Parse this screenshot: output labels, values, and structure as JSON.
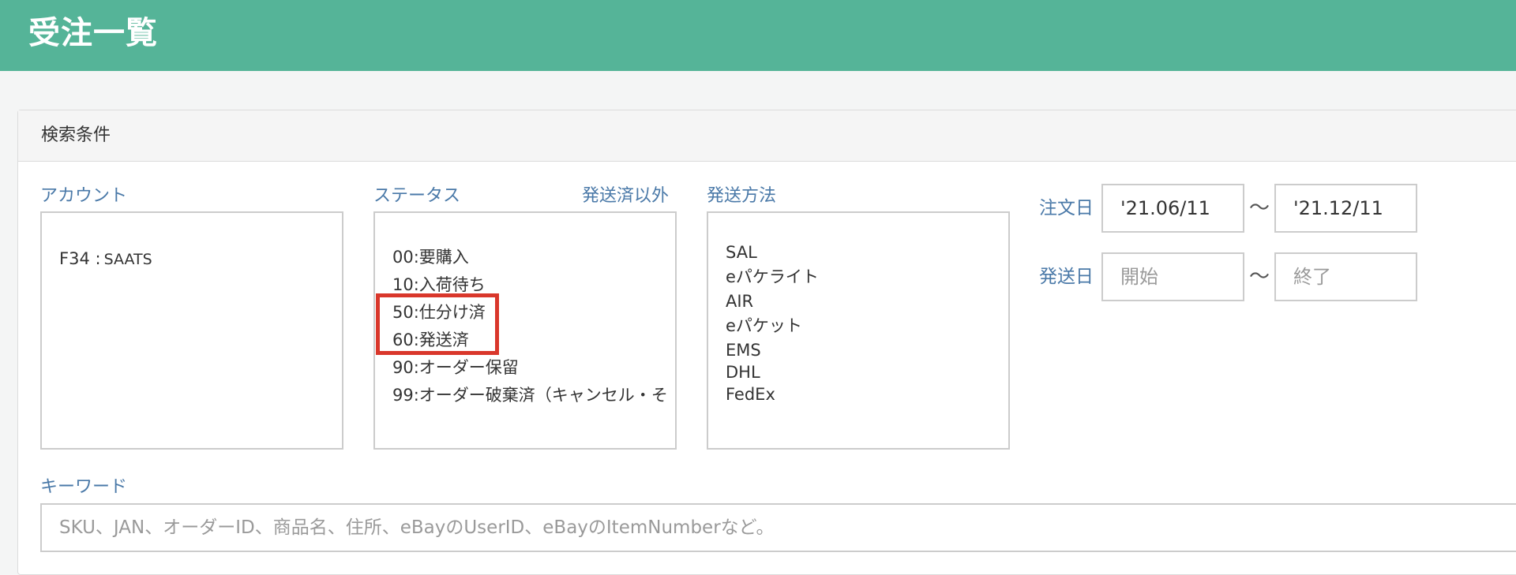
{
  "header": {
    "title": "受注一覧",
    "background_color": "#55b498"
  },
  "search": {
    "heading": "検索条件",
    "account": {
      "label": "アカウント",
      "options": [
        {
          "code": "F34 :",
          "name": "SAATS"
        }
      ]
    },
    "status": {
      "label": "ステータス",
      "quick_link": "発送済以外",
      "options": [
        "00:要購入",
        "10:入荷待ち",
        "50:仕分け済",
        "60:発送済",
        "90:オーダー保留",
        "99:オーダー破棄済（キャンセル・そ"
      ],
      "highlighted": [
        "50:仕分け済",
        "60:発送済"
      ],
      "highlight_color": "#d9372b"
    },
    "shipping_method": {
      "label": "発送方法",
      "options": [
        "SAL",
        "eパケライト",
        "AIR",
        "eパケット",
        "EMS",
        "DHL",
        "FedEx"
      ]
    },
    "order_date": {
      "label": "注文日",
      "from_value": "'21.06/11",
      "to_value": "'21.12/11",
      "separator": "〜"
    },
    "ship_date": {
      "label": "発送日",
      "from_placeholder": "開始",
      "to_placeholder": "終了",
      "separator": "〜"
    },
    "keyword": {
      "label": "キーワード",
      "placeholder": "SKU、JAN、オーダーID、商品名、住所、eBayのUserID、eBayのItemNumberなど。"
    }
  }
}
